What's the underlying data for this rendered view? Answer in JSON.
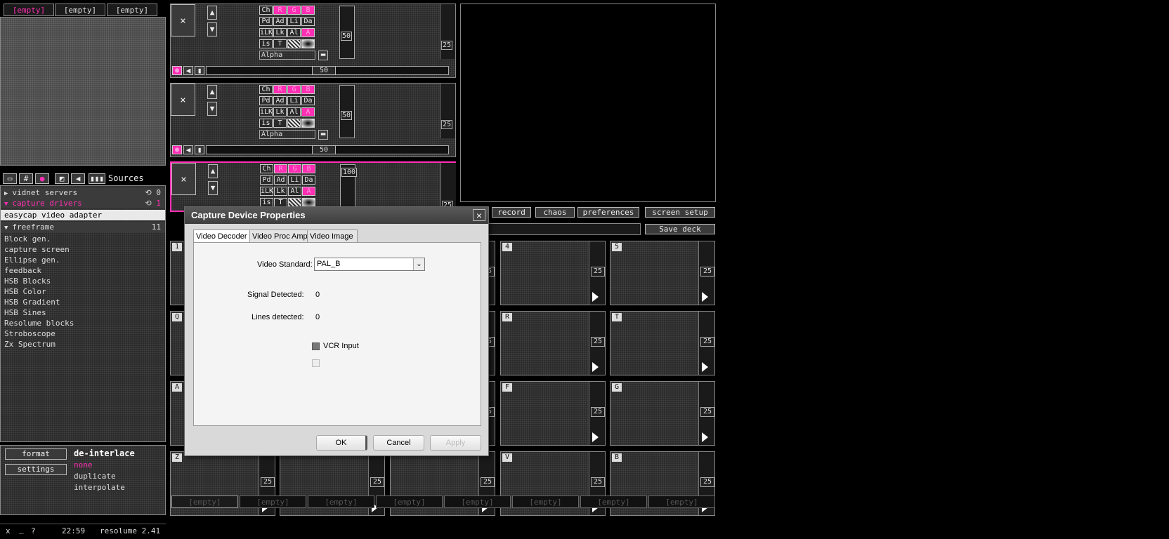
{
  "top_tabs": [
    "[empty]",
    "[empty]",
    "[empty]"
  ],
  "sources": {
    "title": "Sources",
    "servers": {
      "label": "vidnet servers",
      "count": "0"
    },
    "drivers": {
      "label": "capture drivers",
      "count": "1"
    },
    "driver_item": "easycap video adapter",
    "freeframe": {
      "label": "freeframe",
      "count": "11"
    },
    "freeframe_items": [
      "Block gen.",
      "capture screen",
      "Ellipse gen.",
      "feedback",
      "HSB Blocks",
      "HSB Color",
      "HSB Gradient",
      "HSB Sines",
      "Resolume blocks",
      "Stroboscope",
      "Zx Spectrum"
    ]
  },
  "bottom_left": {
    "format_label": "format",
    "settings_label": "settings",
    "deinterlace_title": "de-interlace",
    "options": [
      "none",
      "duplicate",
      "interpolate"
    ]
  },
  "status": {
    "close": "x",
    "minimize": "_",
    "help": "?",
    "time": "22:59",
    "version": "resolume 2.41"
  },
  "layer": {
    "row1": [
      "Ch",
      "R",
      "G",
      "B"
    ],
    "row2": [
      "Pd",
      "Ad",
      "Li",
      "Da"
    ],
    "row3": [
      "iLK",
      "Lk",
      "Al",
      "A"
    ],
    "row4": [
      "is",
      "T"
    ],
    "alpha_label": "Alpha",
    "close": "×"
  },
  "layers": [
    {
      "opacity": "50",
      "level": "25",
      "blend": "50"
    },
    {
      "opacity": "50",
      "level": "25",
      "blend": "50"
    },
    {
      "opacity": "100",
      "level": "25"
    }
  ],
  "toolbar": {
    "record": "record",
    "chaos": "chaos",
    "preferences": "preferences",
    "screen_setup": "screen setup",
    "save_deck": "Save deck"
  },
  "clip_value": "25",
  "clips": {
    "row1": [
      "1",
      "",
      "",
      "4",
      "5"
    ],
    "row2": [
      "Q",
      "",
      "",
      "R",
      "T"
    ],
    "row3": [
      "A",
      "",
      "",
      "F",
      "G"
    ],
    "row4": [
      "Z",
      "",
      "",
      "V",
      "B"
    ]
  },
  "deck_tabs": [
    "[empty]",
    "[empty]",
    "[empty]",
    "[empty]",
    "[empty]",
    "[empty]",
    "[empty]",
    "[empty]"
  ],
  "dialog": {
    "title": "Capture Device Properties",
    "close": "×",
    "tabs": [
      "Video Decoder",
      "Video Proc Amp",
      "Video Image"
    ],
    "video_standard_label": "Video Standard:",
    "video_standard_value": "PAL_B",
    "signal_label": "Signal Detected:",
    "signal_value": "0",
    "lines_label": "Lines detected:",
    "lines_value": "0",
    "vcr_label": "VCR Input",
    "ok": "OK",
    "cancel": "Cancel",
    "apply": "Apply"
  },
  "colors": {
    "accent": "#ff2fb3",
    "background": "#000000",
    "panel": "#2b2b2b"
  }
}
